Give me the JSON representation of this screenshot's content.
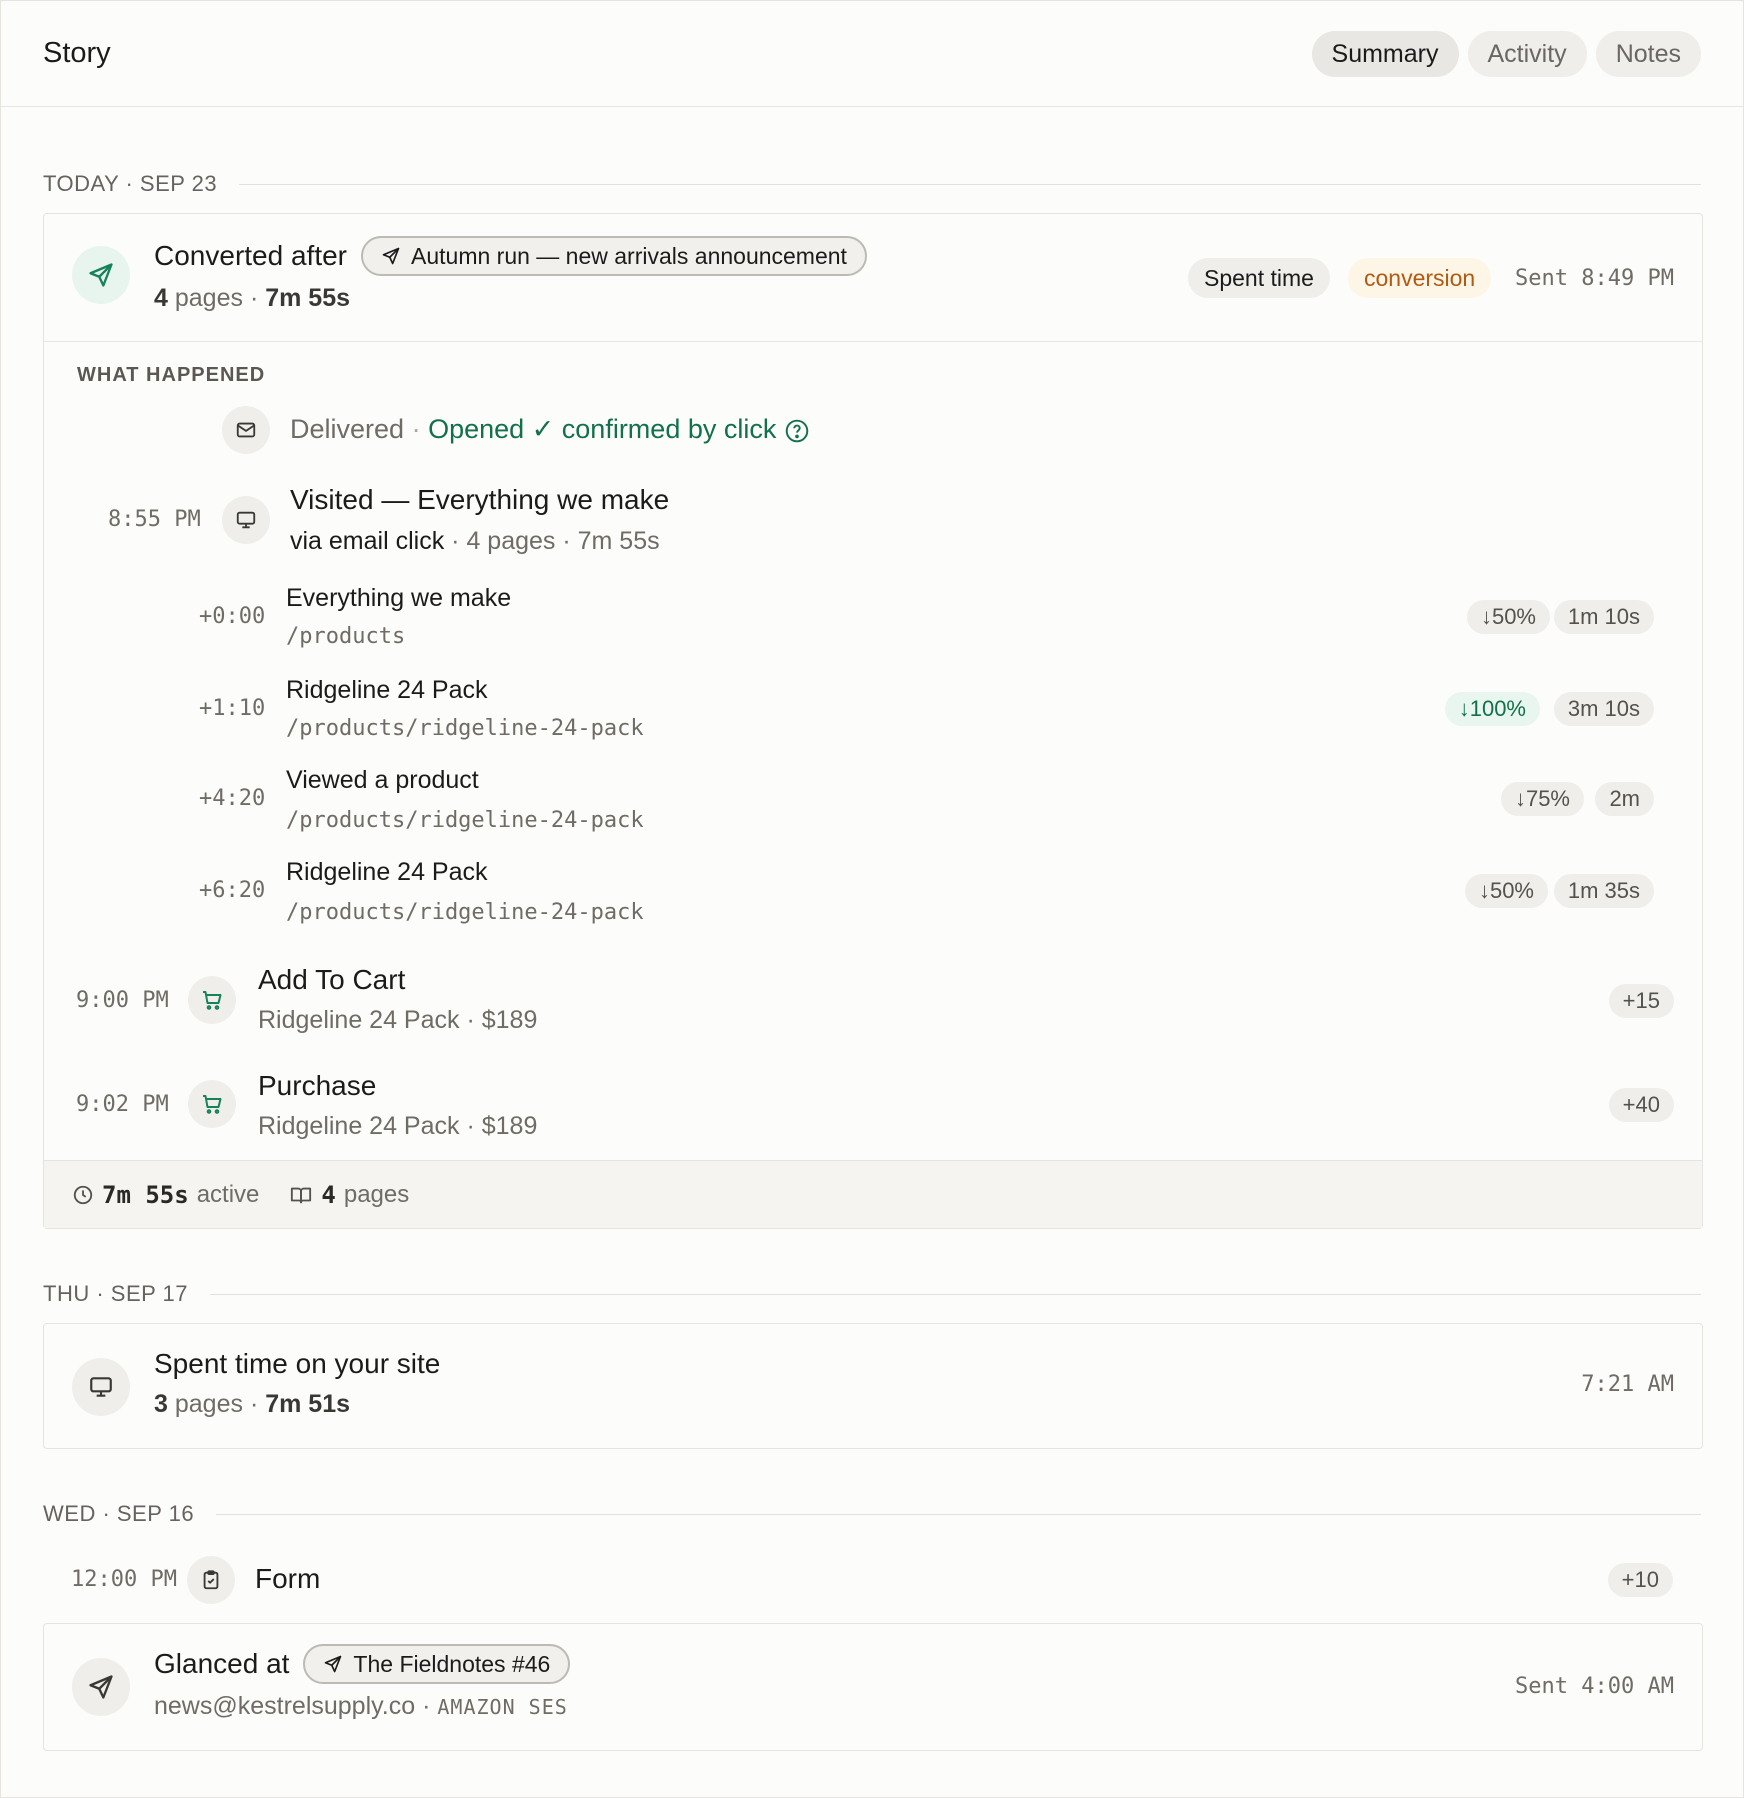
{
  "header": {
    "title": "Story",
    "tabs": [
      {
        "label": "Summary",
        "active": true
      },
      {
        "label": "Activity",
        "active": false
      },
      {
        "label": "Notes",
        "active": false
      }
    ]
  },
  "groups": [
    {
      "date": "TODAY · SEP 23",
      "conversion_card": {
        "title_prefix": "Converted after",
        "campaign": "Autumn run — new arrivals announcement",
        "pages_count": "4",
        "pages_word": "pages",
        "duration": "7m 55s",
        "tag_spent": "Spent time",
        "tag_conversion": "conversion",
        "sent": "Sent 8:49 PM",
        "section_label": "WHAT HAPPENED",
        "delivered": "Delivered",
        "opened": "Opened ✓ confirmed by click",
        "visit": {
          "time": "8:55 PM",
          "title": "Visited — Everything we make",
          "via": "via email click",
          "meta": "4 pages · 7m 55s"
        },
        "pages": [
          {
            "offset": "+0:00",
            "title": "Everything we make",
            "path": "/products",
            "scroll": "↓50%",
            "time": "1m 10s",
            "full": false
          },
          {
            "offset": "+1:10",
            "title": "Ridgeline 24 Pack",
            "path": "/products/ridgeline-24-pack",
            "scroll": "↓100%",
            "time": "3m 10s",
            "full": true
          },
          {
            "offset": "+4:20",
            "title": "Viewed a product",
            "path": "/products/ridgeline-24-pack",
            "scroll": "↓75%",
            "time": "2m",
            "full": false
          },
          {
            "offset": "+6:20",
            "title": "Ridgeline 24 Pack",
            "path": "/products/ridgeline-24-pack",
            "scroll": "↓50%",
            "time": "1m 35s",
            "full": false
          }
        ],
        "events": [
          {
            "time": "9:00 PM",
            "title": "Add To Cart",
            "detail": "Ridgeline 24 Pack · $189",
            "score": "+15"
          },
          {
            "time": "9:02 PM",
            "title": "Purchase",
            "detail": "Ridgeline 24 Pack · $189",
            "score": "+40"
          }
        ],
        "footer": {
          "active_value": "7m 55s",
          "active_word": "active",
          "pages_value": "4",
          "pages_word": "pages"
        }
      }
    },
    {
      "date": "THU · SEP 17",
      "card": {
        "title": "Spent time on your site",
        "pages_count": "3",
        "pages_word": "pages",
        "duration": "7m 51s",
        "time": "7:21 AM"
      }
    },
    {
      "date": "WED · SEP 16",
      "form_event": {
        "time": "12:00 PM",
        "title": "Form",
        "score": "+10"
      },
      "glance_card": {
        "title_prefix": "Glanced at",
        "campaign": "The Fieldnotes #46",
        "sender": "news@kestrelsupply.co",
        "provider": "AMAZON SES",
        "sent": "Sent 4:00 AM"
      }
    }
  ]
}
